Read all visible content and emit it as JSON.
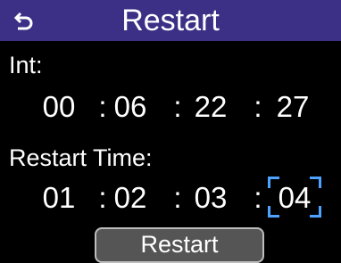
{
  "header": {
    "title": "Restart",
    "back_icon": "back-arrow-icon",
    "color": "#3b2f86"
  },
  "int": {
    "label": "Int:",
    "values": [
      "00",
      "06",
      "22",
      "27"
    ],
    "separator": ":"
  },
  "restart_time": {
    "label": "Restart Time:",
    "values": [
      "01",
      "02",
      "03",
      "04"
    ],
    "separator": ":",
    "selected_index": 3,
    "selected_color": "#4da3ff"
  },
  "restart_button": {
    "label": "Restart"
  }
}
